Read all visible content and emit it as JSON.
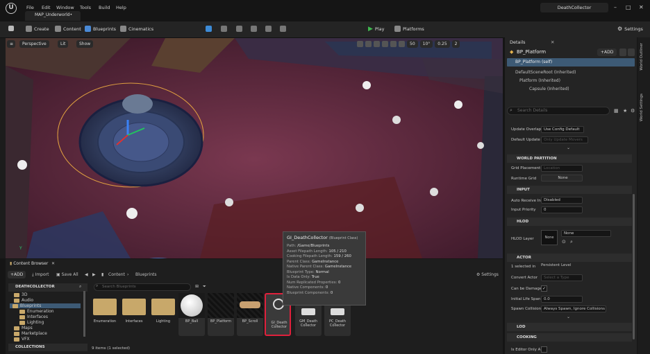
{
  "titlebar": {
    "menu": [
      "File",
      "Edit",
      "Window",
      "Tools",
      "Build",
      "Help"
    ],
    "map_tab": "MAP_Underworld•",
    "app_title": "DeathCollector",
    "min": "–",
    "max": "□",
    "close": "✕"
  },
  "toolbar": {
    "create": "Create",
    "content": "Content",
    "blueprints": "Blueprints",
    "cinematics": "Cinematics",
    "play": "Play",
    "platforms": "Platforms",
    "settings": "Settings"
  },
  "viewport": {
    "perspective": "Perspective",
    "lit": "Lit",
    "show": "Show",
    "snap1": "50",
    "snap2": "10°",
    "snap3": "0.25",
    "cam": "2",
    "axis": "Y"
  },
  "details": {
    "tab": "Details",
    "object": "BP_Platform",
    "add": "+ADD",
    "self": "BP_Platform (self)",
    "components": [
      "DefaultSceneRoot (Inherited)",
      "Platform (Inherited)",
      "Capsule (Inherited)"
    ],
    "search_placeholder": "Search Details",
    "rows_top": [
      {
        "label": "Update Overlap",
        "value": "Use Config Default"
      },
      {
        "label": "Default Update",
        "value": "Only Update Movers"
      }
    ],
    "world_partition": {
      "title": "WORLD PARTITION",
      "rows": [
        {
          "label": "Grid Placement",
          "value": "Location"
        },
        {
          "label": "Runtime Grid",
          "value": "None"
        }
      ]
    },
    "input": {
      "title": "INPUT",
      "rows": [
        {
          "label": "Auto Receive In",
          "value": "Disabled"
        },
        {
          "label": "Input Priority",
          "value": "0"
        }
      ]
    },
    "hlod": {
      "title": "HLOD",
      "label": "HLOD Layer",
      "thumb": "None",
      "value": "None"
    },
    "actor": {
      "title": "ACTOR",
      "selected": "1 selected in",
      "level": "Persistent Level",
      "rows": [
        {
          "label": "Convert Actor",
          "value": "Select a Type"
        },
        {
          "label": "Can be Damage",
          "value": ""
        },
        {
          "label": "Initial Life Span",
          "value": "0.0"
        },
        {
          "label": "Spawn Collision",
          "value": "Always Spawn, Ignore Collisions"
        }
      ]
    },
    "lod": "LOD",
    "cooking": "COOKING",
    "editor_only": "Is Editor Only A",
    "side_tabs": [
      "World Outliner",
      "World Settings"
    ]
  },
  "content_browser": {
    "tab": "Content Browser",
    "add": "+ADD",
    "import": "Import",
    "save_all": "Save All",
    "path": [
      "Content",
      "Blueprints"
    ],
    "settings": "Settings",
    "search_placeholder": "Search Blueprints",
    "root": "DEATHCOLLECTOR",
    "tree": [
      "3D",
      "Audio",
      "Blueprints",
      "Enumeration",
      "Interfaces",
      "Lighting",
      "Maps",
      "Marketplace",
      "VFX"
    ],
    "collections": "COLLECTIONS",
    "assets": [
      {
        "name": "Enumeration",
        "kind": "folder"
      },
      {
        "name": "Interfaces",
        "kind": "folder"
      },
      {
        "name": "Lighting",
        "kind": "folder"
      },
      {
        "name": "BP_Ball",
        "kind": "ball"
      },
      {
        "name": "BP_Platform",
        "kind": "dark"
      },
      {
        "name": "BP_Scroll",
        "kind": "scroll"
      },
      {
        "name": "GI_Death Collector",
        "kind": "gi"
      },
      {
        "name": "GM_Death Collector",
        "kind": "gm"
      },
      {
        "name": "PC_Death Collector",
        "kind": "gm"
      }
    ],
    "status": "9 items (1 selected)"
  },
  "tooltip": {
    "title": "GI_DeathCollector",
    "subtitle": "(Blueprint Class)",
    "lines": [
      [
        "Path:",
        "/Game/Blueprints"
      ],
      [
        "Asset Filepath Length:",
        "105 / 210"
      ],
      [
        "Cooking Filepath Length:",
        "159 / 260"
      ],
      [
        "Parent Class:",
        "GameInstance"
      ],
      [
        "Native Parent Class:",
        "GameInstance"
      ],
      [
        "Blueprint Type:",
        "Normal"
      ],
      [
        "Is Data Only:",
        "True"
      ],
      [
        "Num Replicated Properties:",
        "0"
      ],
      [
        "Native Components:",
        "0"
      ],
      [
        "Blueprint Components:",
        "0"
      ]
    ]
  },
  "colors": {
    "accent": "#0070e0",
    "play": "#3fb950",
    "selection": "#e0203c",
    "folder": "#c8a86a"
  }
}
